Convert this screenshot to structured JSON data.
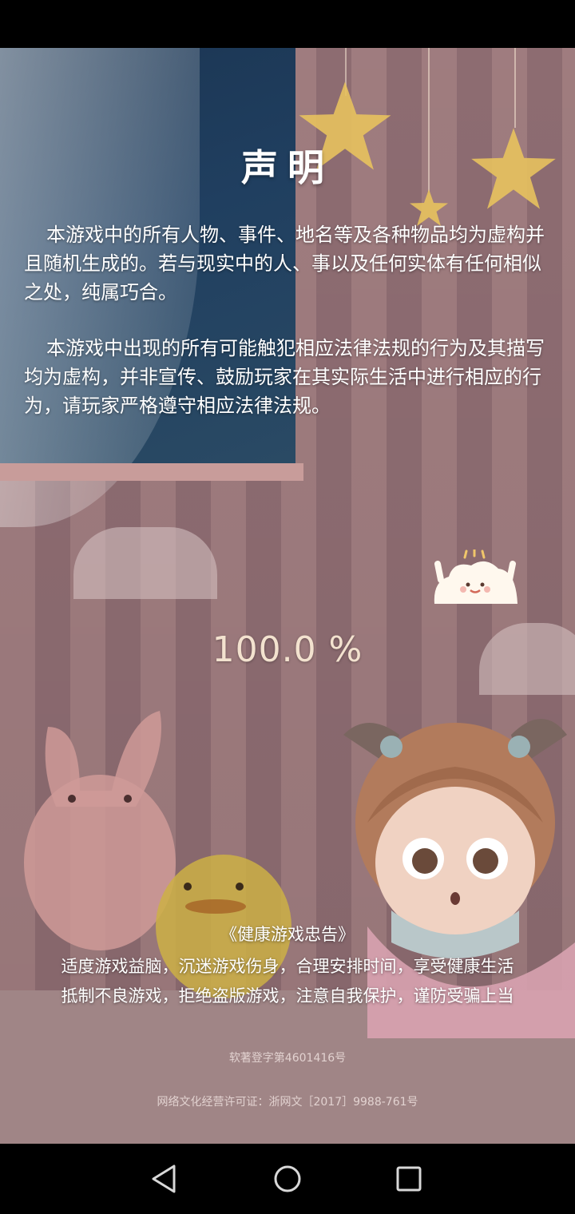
{
  "disclaimer": {
    "title": "声明",
    "paragraph1": "本游戏中的所有人物、事件、地名等及各种物品均为虚构并且随机生成的。若与现实中的人、事以及任何实体有任何相似之处，纯属巧合。",
    "paragraph2": "本游戏中出现的所有可能触犯相应法律法规的行为及其描写均为虚构，并非宣传、鼓励玩家在其实际生活中进行相应的行为，请玩家严格遵守相应法律法规。"
  },
  "loading": {
    "progress_text": "100.0 %",
    "progress_value": 100.0
  },
  "health_advice": {
    "title": "《健康游戏忠告》",
    "line1": "适度游戏益脑，沉迷游戏伤身，合理安排时间，享受健康生活",
    "line2": "抵制不良游戏，拒绝盗版游戏，注意自我保护，谨防受骗上当"
  },
  "registration": {
    "software_copyright": "软著登字第4601416号",
    "license": "网络文化经营许可证：浙网文［2017］9988-761号"
  },
  "nav_bar": {
    "back_icon": "triangle-back-icon",
    "home_icon": "circle-home-icon",
    "recents_icon": "square-recents-icon"
  },
  "colors": {
    "wall": "#b18a8d",
    "night_sky": "#1b3552",
    "progress_text": "#f3e2cf"
  }
}
